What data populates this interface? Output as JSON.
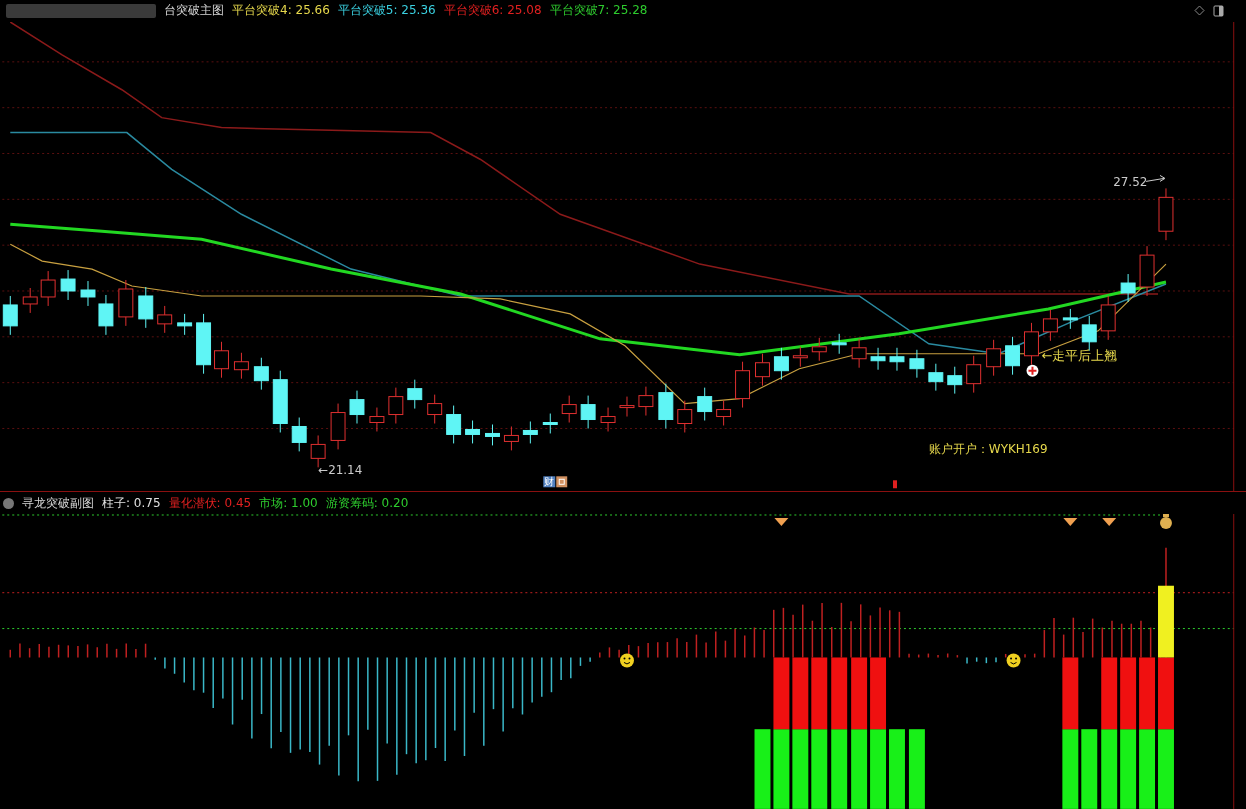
{
  "main_chart": {
    "title": "台突破主图",
    "legend": [
      {
        "label": "平台突破4: 25.66",
        "color": "#e6d84c"
      },
      {
        "label": "平台突破5: 25.36",
        "color": "#3ad0e0"
      },
      {
        "label": "平台突破6: 25.08",
        "color": "#e02020"
      },
      {
        "label": "平台突破7: 25.28",
        "color": "#2ecc2e"
      }
    ],
    "high_label": "27.52",
    "low_label": "←21.14",
    "signal_label": "←走平后上翘",
    "account_note": "账户开户：WYKH169",
    "event_badge": "财"
  },
  "sub_chart": {
    "title": "寻龙突破副图",
    "legend": [
      {
        "label": "柱子: 0.75",
        "color": "#e0e0e0"
      },
      {
        "label": "量化潜伏: 0.45",
        "color": "#e02020"
      },
      {
        "label": "市场: 1.00",
        "color": "#2ecc2e"
      },
      {
        "label": "游资筹码: 0.20",
        "color": "#2ecc2e"
      }
    ]
  }
}
